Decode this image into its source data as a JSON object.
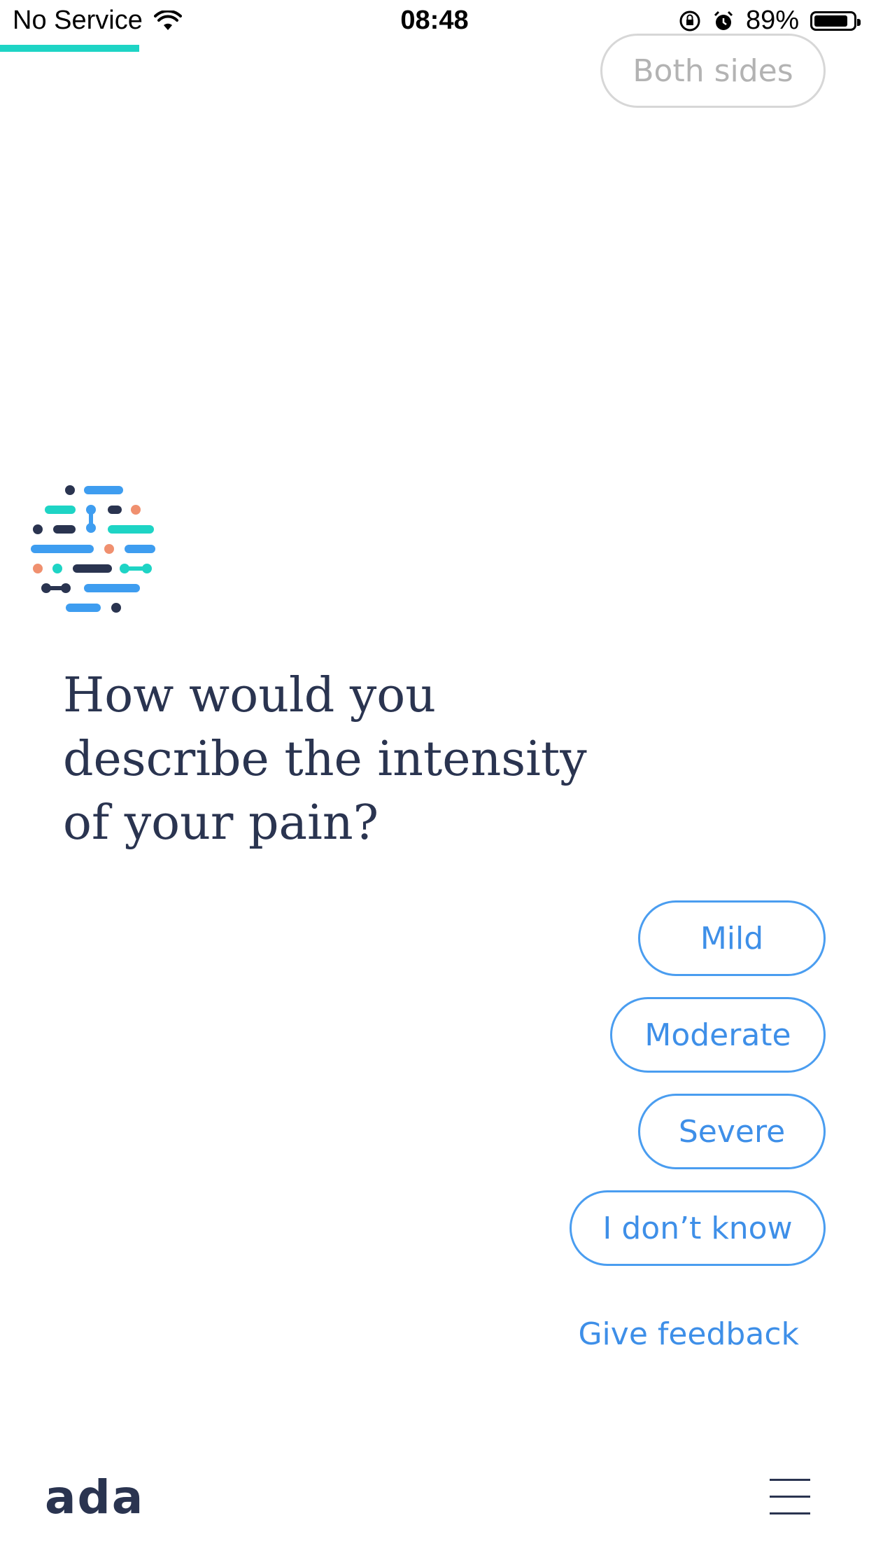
{
  "status_bar": {
    "carrier": "No Service",
    "time": "08:48",
    "battery_percent": "89%",
    "battery_level": 0.89,
    "icons": [
      "wifi-icon",
      "rotation-lock-icon",
      "alarm-icon",
      "battery-icon"
    ]
  },
  "progress": {
    "fraction": 0.16,
    "color": "#1ed4c5"
  },
  "previous_answer": {
    "label": "Both sides"
  },
  "chat": {
    "question": "How would you describe the intensity of your pain?"
  },
  "options": [
    {
      "label": "Mild"
    },
    {
      "label": "Moderate"
    },
    {
      "label": "Severe"
    },
    {
      "label": "I don’t know"
    }
  ],
  "feedback_link": "Give feedback",
  "footer": {
    "logo": "ada",
    "menu_icon": "hamburger-menu-icon"
  },
  "colors": {
    "accent_blue": "#3e8fe8",
    "teal": "#1ed4c5",
    "navy": "#2a3450",
    "salmon": "#f0906f"
  }
}
